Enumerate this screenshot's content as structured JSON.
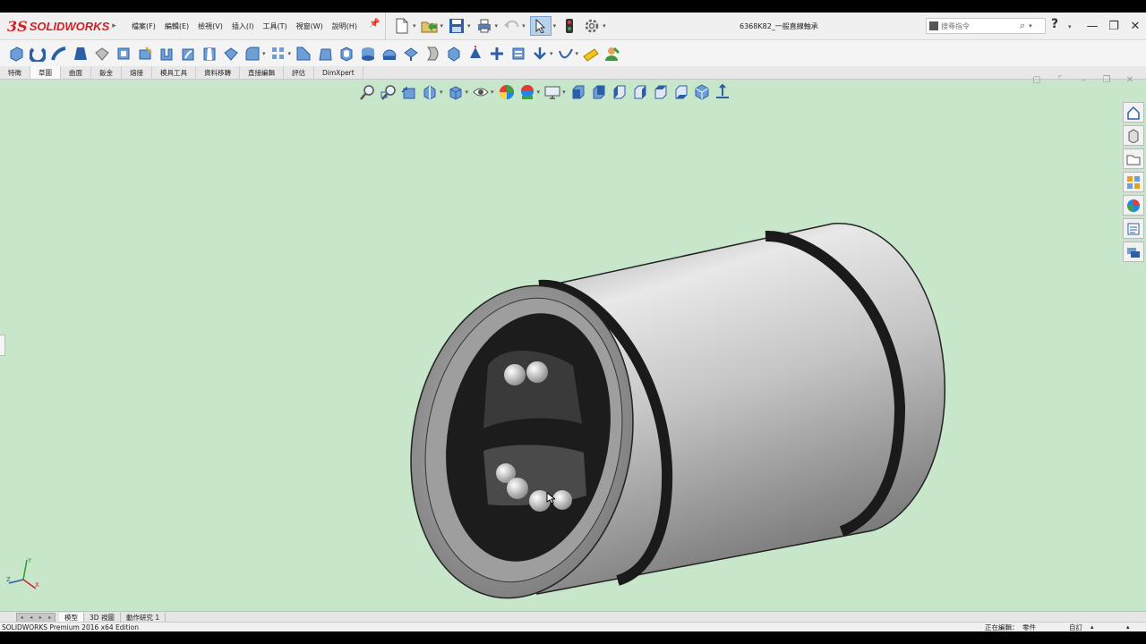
{
  "app": {
    "brand_ds": "3S",
    "brand_name": "SOLIDWORKS",
    "doc_title": "6368K82_一般直線軸承"
  },
  "menu": [
    "檔案(F)",
    "編輯(E)",
    "檢視(V)",
    "插入(I)",
    "工具(T)",
    "視窗(W)",
    "說明(H)"
  ],
  "search": {
    "placeholder": "搜尋指令"
  },
  "help_label": "?",
  "command_tabs": [
    "特徵",
    "草圖",
    "曲面",
    "鈑金",
    "熔接",
    "模具工具",
    "資料移轉",
    "直接編輯",
    "評估",
    "DimXpert"
  ],
  "bottom_tabs": [
    "模型",
    "3D 視圖",
    "動作研究 1"
  ],
  "status": {
    "left": "SOLIDWORKS Premium 2016 x64 Edition",
    "editing": "正在編輯：",
    "editing_target": "零件",
    "units": "自訂"
  },
  "colors": {
    "viewport_bg": "#c8e6c9",
    "brand": "#d32027",
    "accent": "#2a6bd1"
  },
  "triad": {
    "x": "X",
    "y": "Y",
    "z": "Z"
  }
}
